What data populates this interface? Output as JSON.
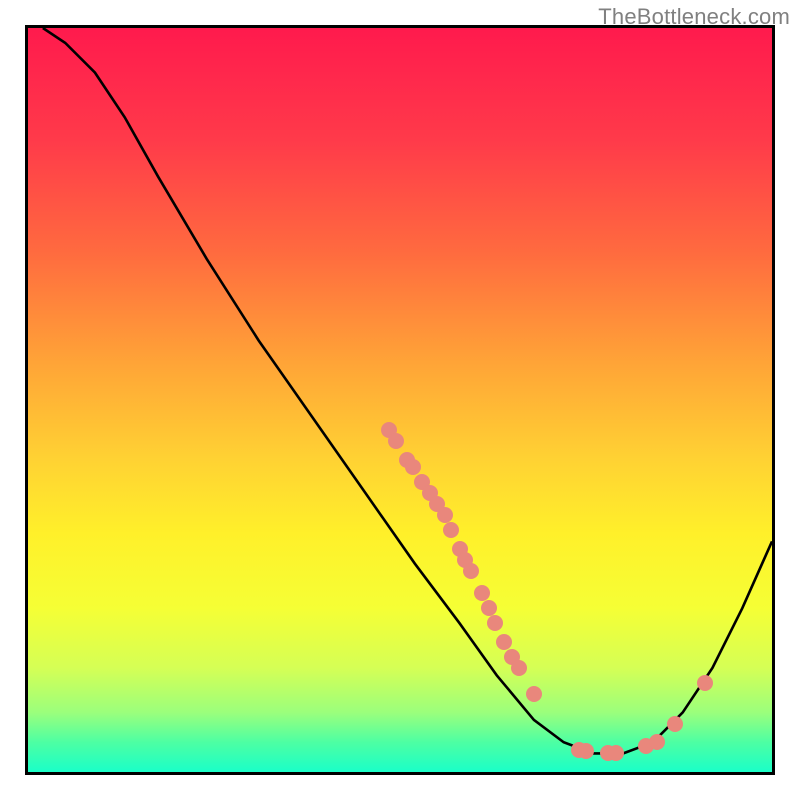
{
  "watermark": "TheBottleneck.com",
  "chart_data": {
    "type": "line",
    "title": "",
    "xlabel": "",
    "ylabel": "",
    "xlim": [
      0,
      100
    ],
    "ylim": [
      0,
      100
    ],
    "grid": false,
    "gradient_stops": [
      {
        "offset": 0.0,
        "color": "#ff1a4d"
      },
      {
        "offset": 0.15,
        "color": "#ff3a4a"
      },
      {
        "offset": 0.3,
        "color": "#ff6a3f"
      },
      {
        "offset": 0.45,
        "color": "#ffa437"
      },
      {
        "offset": 0.58,
        "color": "#ffd233"
      },
      {
        "offset": 0.68,
        "color": "#fff02a"
      },
      {
        "offset": 0.78,
        "color": "#f5ff35"
      },
      {
        "offset": 0.86,
        "color": "#d5ff55"
      },
      {
        "offset": 0.92,
        "color": "#9bff7c"
      },
      {
        "offset": 0.96,
        "color": "#4dffa3"
      },
      {
        "offset": 1.0,
        "color": "#1affc8"
      }
    ],
    "curve": [
      {
        "x": 2,
        "y": 100
      },
      {
        "x": 5,
        "y": 98
      },
      {
        "x": 9,
        "y": 94
      },
      {
        "x": 13,
        "y": 88
      },
      {
        "x": 17.5,
        "y": 80
      },
      {
        "x": 24,
        "y": 69
      },
      {
        "x": 31,
        "y": 58
      },
      {
        "x": 38,
        "y": 48
      },
      {
        "x": 45,
        "y": 38
      },
      {
        "x": 52,
        "y": 28
      },
      {
        "x": 58,
        "y": 20
      },
      {
        "x": 63,
        "y": 13
      },
      {
        "x": 68,
        "y": 7
      },
      {
        "x": 72,
        "y": 4
      },
      {
        "x": 76,
        "y": 2.5
      },
      {
        "x": 80,
        "y": 2.5
      },
      {
        "x": 84,
        "y": 4
      },
      {
        "x": 88,
        "y": 8
      },
      {
        "x": 92,
        "y": 14
      },
      {
        "x": 96,
        "y": 22
      },
      {
        "x": 100,
        "y": 31
      }
    ],
    "markers": [
      {
        "x": 48.5,
        "y": 46
      },
      {
        "x": 49.5,
        "y": 44.5
      },
      {
        "x": 51,
        "y": 42
      },
      {
        "x": 51.8,
        "y": 41
      },
      {
        "x": 53,
        "y": 39
      },
      {
        "x": 54,
        "y": 37.5
      },
      {
        "x": 55,
        "y": 36
      },
      {
        "x": 56,
        "y": 34.5
      },
      {
        "x": 56.8,
        "y": 32.5
      },
      {
        "x": 58,
        "y": 30
      },
      {
        "x": 58.8,
        "y": 28.5
      },
      {
        "x": 59.5,
        "y": 27
      },
      {
        "x": 61,
        "y": 24
      },
      {
        "x": 62,
        "y": 22
      },
      {
        "x": 62.8,
        "y": 20
      },
      {
        "x": 64,
        "y": 17.5
      },
      {
        "x": 65,
        "y": 15.5
      },
      {
        "x": 66,
        "y": 14
      },
      {
        "x": 68,
        "y": 10.5
      },
      {
        "x": 74,
        "y": 3
      },
      {
        "x": 75,
        "y": 2.8
      },
      {
        "x": 78,
        "y": 2.5
      },
      {
        "x": 79,
        "y": 2.5
      },
      {
        "x": 83,
        "y": 3.5
      },
      {
        "x": 84.5,
        "y": 4
      },
      {
        "x": 87,
        "y": 6.5
      },
      {
        "x": 91,
        "y": 12
      }
    ]
  }
}
